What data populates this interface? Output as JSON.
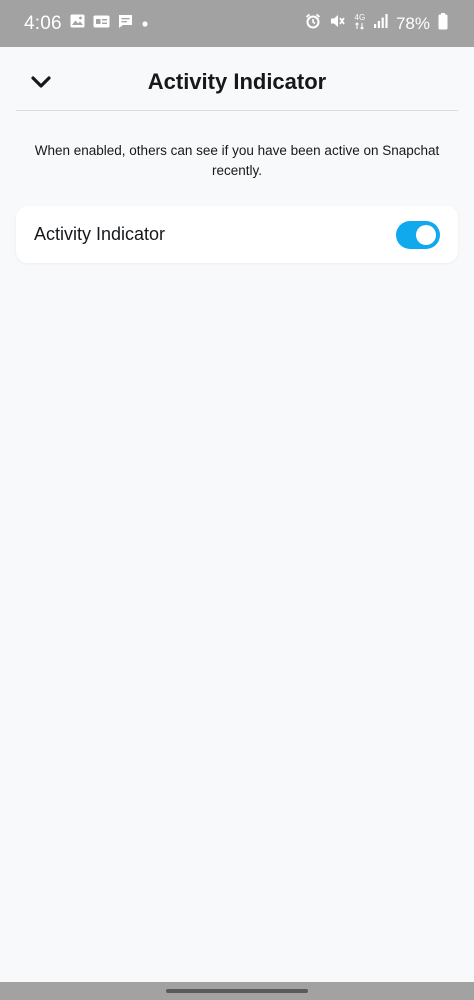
{
  "status_bar": {
    "time": "4:06",
    "network": "4G",
    "battery_percent": "78%",
    "icons_left": [
      "gallery-icon",
      "gs-icon",
      "message-icon",
      "dot-icon"
    ],
    "icons_right": [
      "alarm-icon",
      "mute-icon",
      "network-4g-icon",
      "signal-icon",
      "battery-icon"
    ]
  },
  "header": {
    "title": "Activity Indicator",
    "back_icon": "chevron-down-icon"
  },
  "description": "When enabled, others can see if you have been active on Snapchat recently.",
  "setting": {
    "label": "Activity Indicator",
    "enabled": true
  },
  "colors": {
    "accent": "#10a9ee",
    "background": "#f8f9fb",
    "status_bar": "#a2a2a2",
    "text": "#16191c"
  }
}
